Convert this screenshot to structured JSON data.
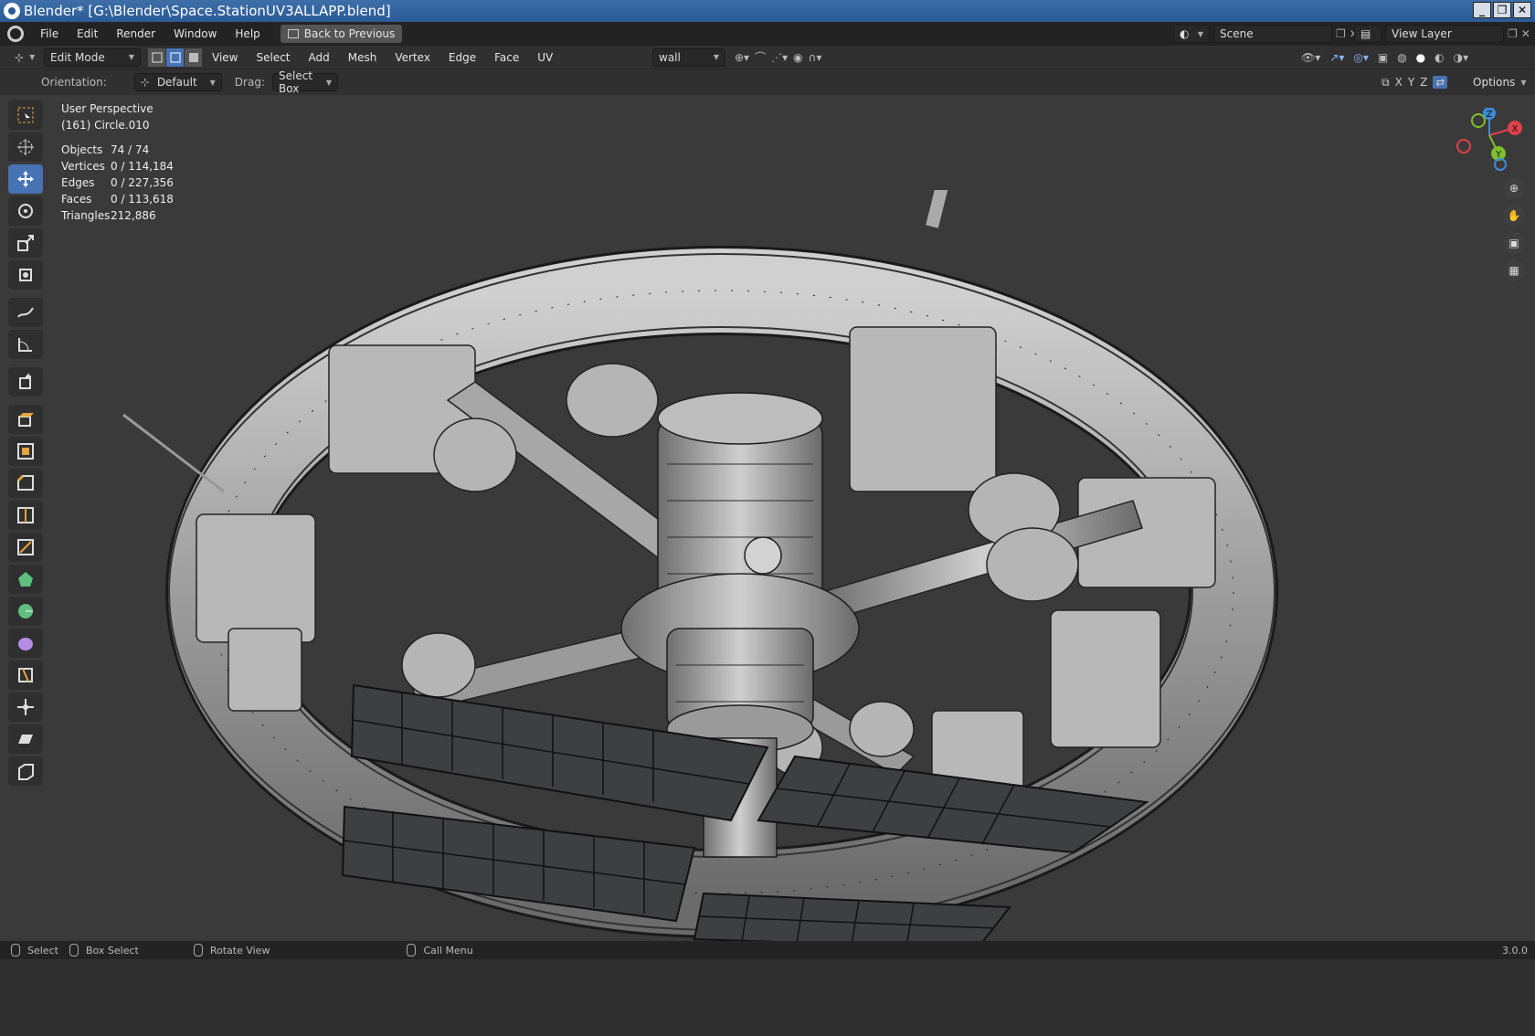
{
  "title": {
    "text": "Blender* [G:\\Blender\\Space.StationUV3ALLAPP.blend]"
  },
  "window_controls": {
    "minimize": "_",
    "restore": "❐",
    "close": "✕"
  },
  "menubar": {
    "items": [
      "File",
      "Edit",
      "Render",
      "Window",
      "Help"
    ],
    "back_button": "Back to Previous",
    "scene_label": "Scene",
    "view_layer_label": "View Layer"
  },
  "header": {
    "mode": "Edit Mode",
    "menus": [
      "View",
      "Select",
      "Add",
      "Mesh",
      "Vertex",
      "Edge",
      "Face",
      "UV"
    ],
    "attribute_select": "wall"
  },
  "tool_header": {
    "orientation_label": "Orientation:",
    "orientation_value": "Default",
    "drag_label": "Drag:",
    "drag_value": "Select Box",
    "axes": [
      "X",
      "Y",
      "Z"
    ],
    "options_label": "Options"
  },
  "overlay": {
    "view_name": "User Perspective",
    "object_name": "(161) Circle.010",
    "stats": [
      {
        "label": "Objects",
        "value": "74 / 74"
      },
      {
        "label": "Vertices",
        "value": "0 / 114,184"
      },
      {
        "label": "Edges",
        "value": "0 / 227,356"
      },
      {
        "label": "Faces",
        "value": "0 / 113,618"
      },
      {
        "label": "Triangles",
        "value": "212,886"
      }
    ]
  },
  "gizmo": {
    "x": "X",
    "y": "Y",
    "z": "Z"
  },
  "statusbar": {
    "select": "Select",
    "box_select": "Box Select",
    "rotate_view": "Rotate View",
    "call_menu": "Call Menu",
    "version": "3.0.0"
  },
  "colors": {
    "accent": "#4772b3",
    "title_bar": "#2b5b96"
  }
}
